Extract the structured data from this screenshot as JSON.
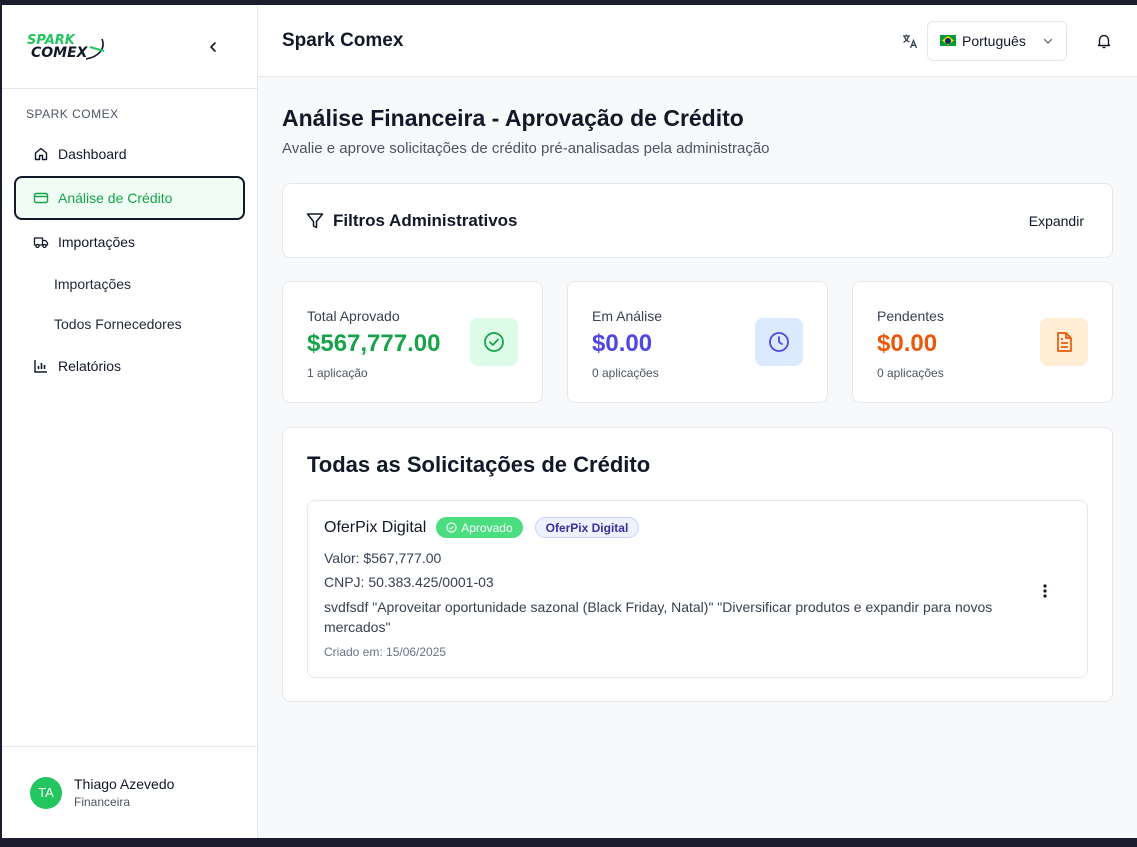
{
  "brand": {
    "logo_line1": "SPARK",
    "logo_line2": "COMEX",
    "accent": "#22c55e"
  },
  "sidebar": {
    "section_label": "SPARK COMEX",
    "items": [
      {
        "label": "Dashboard",
        "icon": "home-icon"
      },
      {
        "label": "Análise de Crédito",
        "icon": "credit-card-icon",
        "active": true
      },
      {
        "label": "Importações",
        "icon": "truck-icon"
      }
    ],
    "sub_items": [
      {
        "label": "Importações"
      },
      {
        "label": "Todos Fornecedores"
      }
    ],
    "reports": {
      "label": "Relatórios",
      "icon": "bar-chart-icon"
    },
    "user": {
      "initials": "TA",
      "name": "Thiago Azevedo",
      "role": "Financeira"
    }
  },
  "header": {
    "title": "Spark Comex",
    "language": "Português"
  },
  "page": {
    "title": "Análise Financeira - Aprovação de Crédito",
    "subtitle": "Avalie e aprove solicitações de crédito pré-analisadas pela administração"
  },
  "filters": {
    "title": "Filtros Administrativos",
    "expand_label": "Expandir"
  },
  "stats": [
    {
      "label": "Total Aprovado",
      "value": "$567,777.00",
      "count": "1 aplicação",
      "color": "#16a34a",
      "icon": "check-circle-icon",
      "icon_bg": "#dcfce7"
    },
    {
      "label": "Em Análise",
      "value": "$0.00",
      "count": "0 aplicações",
      "color": "#4f46e5",
      "icon": "clock-icon",
      "icon_bg": "#dbeafe"
    },
    {
      "label": "Pendentes",
      "value": "$0.00",
      "count": "0 aplicações",
      "color": "#ea580c",
      "icon": "file-text-icon",
      "icon_bg": "#ffedd5"
    }
  ],
  "requests": {
    "title": "Todas as Solicitações de Crédito",
    "items": [
      {
        "company": "OferPix Digital",
        "status": "Aprovado",
        "tag": "OferPix Digital",
        "value_line": "Valor: $567,777.00",
        "cnpj_line": "CNPJ: 50.383.425/0001-03",
        "description": "svdfsdf \"Aproveitar oportunidade sazonal (Black Friday, Natal)\" \"Diversificar produtos e expandir para novos mercados\"",
        "created": "Criado em: 15/06/2025"
      }
    ]
  }
}
